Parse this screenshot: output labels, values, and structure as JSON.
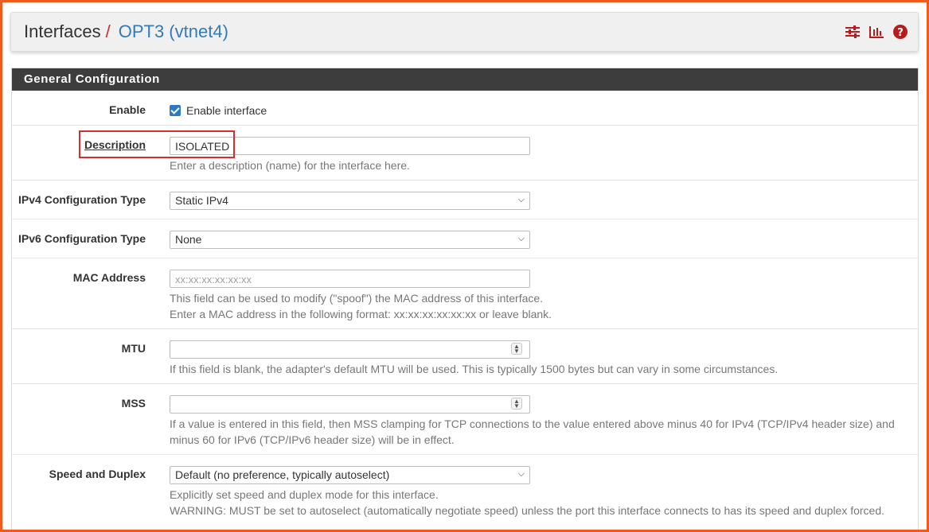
{
  "breadcrumb": {
    "root": "Interfaces",
    "separator": "/",
    "current": "OPT3 (vtnet4)"
  },
  "header_icons": [
    "sliders-icon",
    "bar-chart-icon",
    "help-icon"
  ],
  "colors": {
    "accent": "#337ab7",
    "separator": "#c9302c",
    "panel_heading_bg": "#3d3d3d",
    "highlight_box": "#d32f2f",
    "frame": "#f05a1a"
  },
  "panel": {
    "title": "General Configuration",
    "enable": {
      "label": "Enable",
      "checkbox_label": "Enable interface",
      "checked": true
    },
    "description": {
      "label": "Description",
      "value": "ISOLATED",
      "help": "Enter a description (name) for the interface here."
    },
    "ipv4_type": {
      "label": "IPv4 Configuration Type",
      "value": "Static IPv4"
    },
    "ipv6_type": {
      "label": "IPv6 Configuration Type",
      "value": "None"
    },
    "mac": {
      "label": "MAC Address",
      "placeholder": "xx:xx:xx:xx:xx:xx",
      "help1": "This field can be used to modify (\"spoof\") the MAC address of this interface.",
      "help2": "Enter a MAC address in the following format: xx:xx:xx:xx:xx:xx or leave blank."
    },
    "mtu": {
      "label": "MTU",
      "value": "",
      "help": "If this field is blank, the adapter's default MTU will be used. This is typically 1500 bytes but can vary in some circumstances."
    },
    "mss": {
      "label": "MSS",
      "value": "",
      "help1": "If a value is entered in this field, then MSS clamping for TCP connections to the value entered above minus 40 for IPv4 (TCP/IPv4 header size) and",
      "help2": "minus 60 for IPv6 (TCP/IPv6 header size) will be in effect."
    },
    "speed": {
      "label": "Speed and Duplex",
      "value": "Default (no preference, typically autoselect)",
      "help1": "Explicitly set speed and duplex mode for this interface.",
      "help2": "WARNING: MUST be set to autoselect (automatically negotiate speed) unless the port this interface connects to has its speed and duplex forced."
    }
  }
}
